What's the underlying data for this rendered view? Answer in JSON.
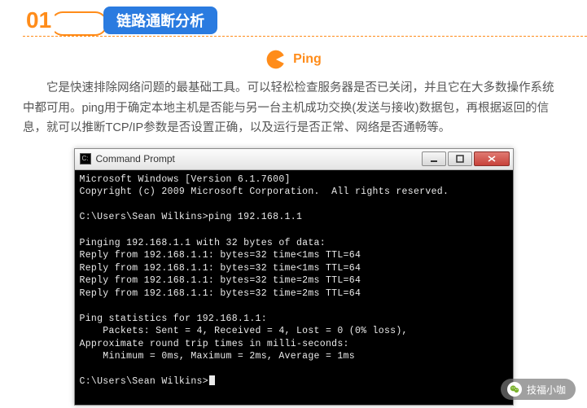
{
  "header": {
    "number": "01",
    "title": "链路通断分析"
  },
  "ping_label": "Ping",
  "body_text": "它是快速排除网络问题的最基础工具。可以轻松检查服务器是否已关闭，并且它在大多数操作系统中都可用。ping用于确定本地主机是否能与另一台主机成功交换(发送与接收)数据包，再根据返回的信息，就可以推断TCP/IP参数是否设置正确，以及运行是否正常、网络是否通畅等。",
  "console": {
    "title": "Command Prompt",
    "lines": [
      "Microsoft Windows [Version 6.1.7600]",
      "Copyright (c) 2009 Microsoft Corporation.  All rights reserved.",
      "",
      "C:\\Users\\Sean Wilkins>ping 192.168.1.1",
      "",
      "Pinging 192.168.1.1 with 32 bytes of data:",
      "Reply from 192.168.1.1: bytes=32 time<1ms TTL=64",
      "Reply from 192.168.1.1: bytes=32 time<1ms TTL=64",
      "Reply from 192.168.1.1: bytes=32 time=2ms TTL=64",
      "Reply from 192.168.1.1: bytes=32 time=2ms TTL=64",
      "",
      "Ping statistics for 192.168.1.1:",
      "    Packets: Sent = 4, Received = 4, Lost = 0 (0% loss),",
      "Approximate round trip times in milli-seconds:",
      "    Minimum = 0ms, Maximum = 2ms, Average = 1ms",
      "",
      "C:\\Users\\Sean Wilkins>"
    ]
  },
  "wechat": {
    "label": "技福小咖"
  }
}
